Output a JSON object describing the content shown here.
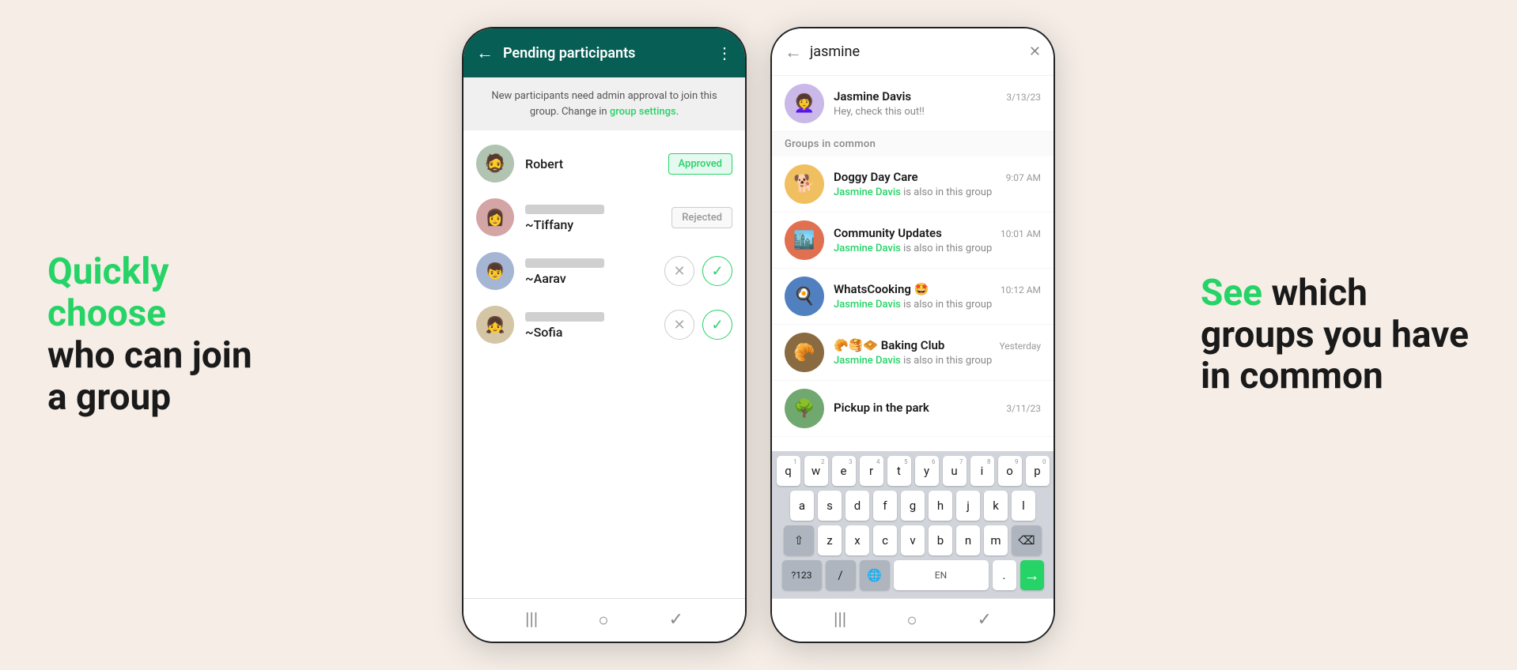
{
  "page": {
    "background": "#f5ede6"
  },
  "left_section": {
    "line1": "Quickly",
    "line2": "choose",
    "line3": "who can join",
    "line4": "a group",
    "green_words": [
      "Quickly",
      "choose"
    ]
  },
  "right_section": {
    "see_word": "See",
    "rest": " which groups you have in common"
  },
  "phone1": {
    "header": {
      "title": "Pending participants",
      "back_label": "←",
      "more_label": "⋮"
    },
    "notice": {
      "text": "New participants need admin approval to join this group. Change in ",
      "link_text": "group settings",
      "text_end": "."
    },
    "participants": [
      {
        "name": "Robert",
        "phone": null,
        "status": "Approved",
        "avatar_emoji": "🧔"
      },
      {
        "name": "~Tiffany",
        "phone": "blurred",
        "status": "Rejected",
        "avatar_emoji": "👩"
      },
      {
        "name": "~Aarav",
        "phone": "blurred",
        "status": "pending",
        "avatar_emoji": "👦"
      },
      {
        "name": "~Sofia",
        "phone": "blurred",
        "status": "pending",
        "avatar_emoji": "👧"
      }
    ],
    "bottom_icons": [
      "|||",
      "○",
      "✓"
    ]
  },
  "phone2": {
    "header": {
      "back_label": "←",
      "search_value": "jasmine",
      "close_label": "✕"
    },
    "direct_chat": {
      "name": "Jasmine Davis",
      "time": "3/13/23",
      "message": "Hey, check this out!!",
      "avatar_emoji": "👩‍🦱"
    },
    "groups_header": "Groups in common",
    "groups": [
      {
        "name": "Doggy Day Care",
        "time": "9:07 AM",
        "avatar_emoji": "🐕",
        "sender": "Jasmine Davis",
        "message": " is also in this group",
        "unread": null
      },
      {
        "name": "Community Updates",
        "time": "10:01 AM",
        "avatar_emoji": "🏙️",
        "sender": "Jasmine Davis",
        "message": " is also in this group",
        "unread": null
      },
      {
        "name": "WhatsCooking 🤩",
        "time": "10:12 AM",
        "avatar_emoji": "🍳",
        "sender": "Jasmine Davis",
        "message": " is also in this group",
        "unread": null
      },
      {
        "name": "🥐🥞🧇 Baking Club",
        "time": "Yesterday",
        "avatar_emoji": "🥐",
        "sender": "Jasmine Davis",
        "message": " is also in this group",
        "unread": null
      },
      {
        "name": "Pickup in the park",
        "time": "3/11/23",
        "avatar_emoji": "🌳",
        "sender": null,
        "message": "",
        "unread": null
      }
    ],
    "keyboard": {
      "rows": [
        [
          "q",
          "w",
          "e",
          "r",
          "t",
          "y",
          "u",
          "i",
          "o",
          "p"
        ],
        [
          "a",
          "s",
          "d",
          "f",
          "g",
          "h",
          "j",
          "k",
          "l"
        ],
        [
          "z",
          "x",
          "c",
          "v",
          "b",
          "n",
          "m"
        ]
      ],
      "numbers": [
        "1",
        "2",
        "3",
        "4",
        "5",
        "6",
        "7",
        "8",
        "9",
        "0"
      ],
      "bottom": [
        "?123",
        "/",
        "🌐",
        "EN",
        ".",
        "→"
      ]
    }
  }
}
